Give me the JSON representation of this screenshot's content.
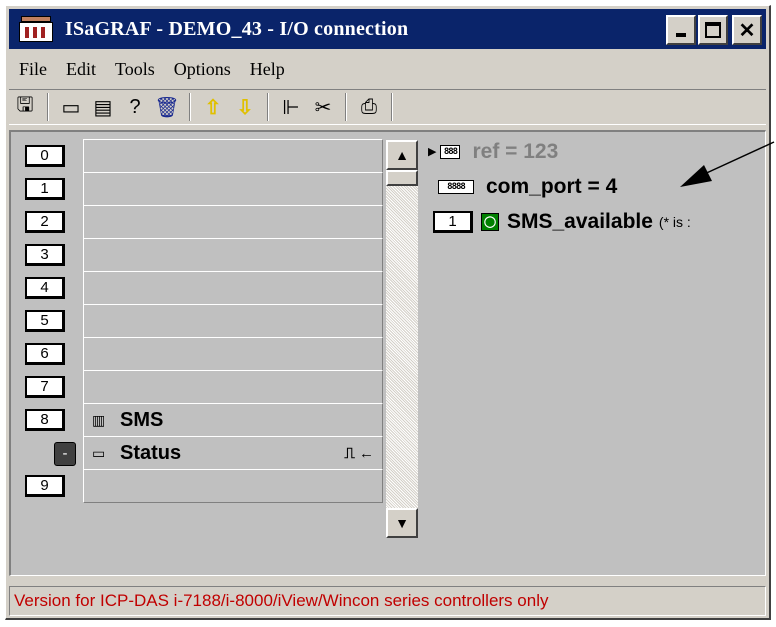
{
  "window": {
    "title": "ISaGRAF - DEMO_43 - I/O connection"
  },
  "menu": [
    "File",
    "Edit",
    "Tools",
    "Options",
    "Help"
  ],
  "toolbar": {
    "icons": [
      "open-board-icon",
      "set-board-icon",
      "calculate-icon",
      "help-board-icon",
      "delete-icon",
      "move-up-icon",
      "move-down-icon",
      "connect-icon",
      "cut-icon",
      "print-icon"
    ]
  },
  "slots": [
    {
      "number": "0",
      "label": ""
    },
    {
      "number": "1",
      "label": ""
    },
    {
      "number": "2",
      "label": ""
    },
    {
      "number": "3",
      "label": ""
    },
    {
      "number": "4",
      "label": ""
    },
    {
      "number": "5",
      "label": ""
    },
    {
      "number": "6",
      "label": ""
    },
    {
      "number": "7",
      "label": ""
    },
    {
      "number": "8",
      "label": "SMS"
    },
    {
      "number": "-",
      "label": "Status",
      "signal": "⎍ ←"
    },
    {
      "number": "9",
      "label": ""
    }
  ],
  "params": {
    "ref": {
      "icon_text": "888",
      "text": "ref = 123"
    },
    "com_port": {
      "icon_text": "8888",
      "text": "com_port = 4"
    },
    "channel": {
      "number": "1",
      "name": "SMS_available",
      "comment": "(* is :"
    }
  },
  "status_text": "Version for ICP-DAS i-7188/i-8000/iView/Wincon series controllers only"
}
